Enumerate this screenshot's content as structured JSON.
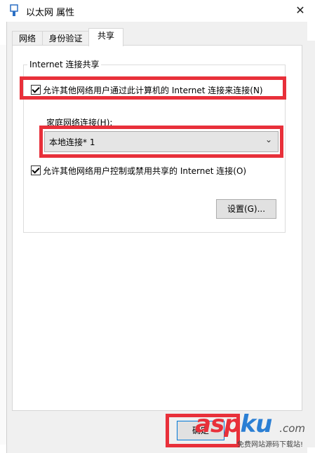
{
  "window": {
    "title": "以太网 属性",
    "close_glyph": "✕"
  },
  "tabs": [
    {
      "label": "网络"
    },
    {
      "label": "身份验证"
    },
    {
      "label": "共享"
    }
  ],
  "sharing": {
    "group_title": "Internet 连接共享",
    "allow_share_label": "允许其他网络用户通过此计算机的 Internet 连接来连接(N)",
    "allow_share_checked": true,
    "home_network_label": "家庭网络连接(H):",
    "home_network_value": "本地连接* 1",
    "allow_control_label": "允许其他网络用户控制或禁用共享的 Internet 连接(O)",
    "allow_control_checked": true,
    "settings_button": "设置(G)..."
  },
  "footer": {
    "ok_button": "确定"
  },
  "watermark": {
    "asp": "asp",
    "ku": "ku",
    "com": ".com",
    "subtitle": "免费网站源码下载站!"
  },
  "colors": {
    "highlight_red": "#e8303a",
    "watermark_blue": "#2b7fd4"
  }
}
